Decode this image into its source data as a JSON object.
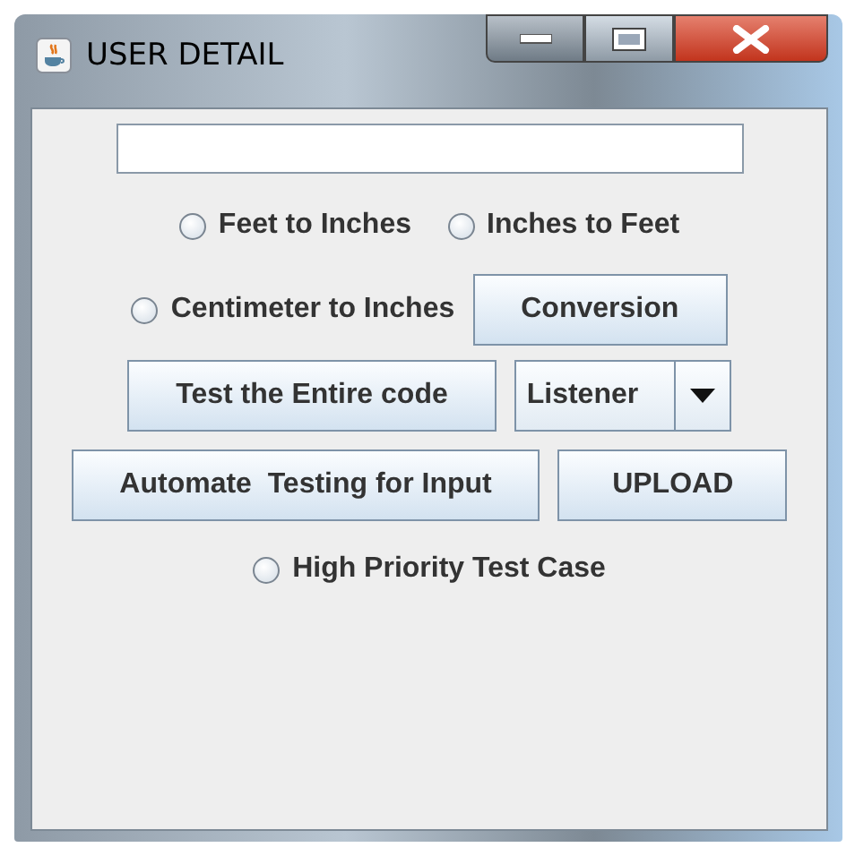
{
  "window": {
    "title": "USER DETAIL"
  },
  "rows": [
    [
      {
        "kind": "radio",
        "label": "Feet to Inches",
        "selected": false
      },
      {
        "kind": "radio",
        "label": "Inches to Feet",
        "selected": false
      }
    ],
    [
      {
        "kind": "radio",
        "label": "Centimeter to Inches",
        "selected": false
      },
      {
        "kind": "button",
        "label": "Conversion"
      }
    ],
    [
      {
        "kind": "button",
        "label": "Test the Entire code"
      },
      {
        "kind": "combo",
        "value": "Listener"
      }
    ],
    [
      {
        "kind": "button",
        "label": "Automate  Testing for Input"
      },
      {
        "kind": "button",
        "label": "UPLOAD"
      }
    ],
    [
      {
        "kind": "radio",
        "label": "High Priority Test Case",
        "selected": false
      }
    ]
  ]
}
